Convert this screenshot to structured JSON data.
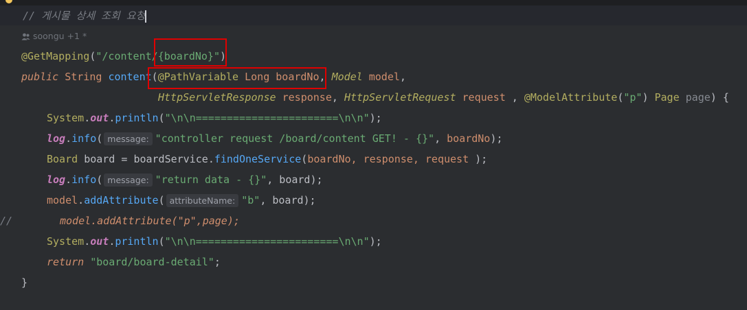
{
  "editor": {
    "comment_line": "// 게시물 상세 조회 요청",
    "author_hint": "soongu +1 *",
    "lines": {
      "get_mapping": {
        "annotation": "@GetMapping",
        "open": "(",
        "path_prefix": "\"/content/",
        "path_var": "{boardNo}\"",
        "close": ")"
      },
      "signature1": {
        "kw": "public",
        "ret": "String",
        "name": "content",
        "open": "(",
        "pv_ann": "@PathVariable",
        "pv_type": "Long",
        "pv_name": "boardNo",
        "comma": ",",
        "model_type": "Model",
        "model_name": "model",
        "comma2": ","
      },
      "signature2": {
        "resp_type": "HttpServletResponse",
        "resp_name": "response",
        "comma1": ",",
        "req_type": "HttpServletRequest",
        "req_name": "request",
        "comma2": " ,",
        "ma_ann": "@ModelAttribute",
        "ma_open": "(",
        "ma_str": "\"p\"",
        "ma_close": ")",
        "page_type": "Page",
        "page_name": "page",
        "end": ") {"
      },
      "println1": {
        "cls": "System",
        "dot": ".",
        "field": "out",
        "dot2": ".",
        "method": "println",
        "open": "(",
        "str": "\"\\n\\n=======================\\n\\n\"",
        "end": ");"
      },
      "log1": {
        "obj": "log",
        "dot": ".",
        "method": "info",
        "open": "(",
        "hint": "message:",
        "str": "\"controller request /board/content GET! - {}\"",
        "comma": ", ",
        "arg": "boardNo",
        "end": ");"
      },
      "board": {
        "type": "Board",
        "var": "board",
        "eq": " = ",
        "svc": "boardService",
        "dot": ".",
        "method": "findOneService",
        "open": "(",
        "args": "boardNo, response, request ",
        "end": ");"
      },
      "log2": {
        "obj": "log",
        "dot": ".",
        "method": "info",
        "open": "(",
        "hint": "message:",
        "str": "\"return data - {}\"",
        "comma": ", ",
        "arg": "board",
        "end": ");"
      },
      "model_add": {
        "obj": "model",
        "dot": ".",
        "method": "addAttribute",
        "open": "(",
        "hint": "attributeName:",
        "str": "\"b\"",
        "comma": ", ",
        "arg": "board",
        "end": ");"
      },
      "commented": {
        "gutter": "//",
        "text": "model.addAttribute(\"p\",page);"
      },
      "println2": {
        "cls": "System",
        "dot": ".",
        "field": "out",
        "dot2": ".",
        "method": "println",
        "open": "(",
        "str": "\"\\n\\n=======================\\n\\n\"",
        "end": ");"
      },
      "ret": {
        "kw": "return",
        "str": "\"board/board-detail\"",
        "end": ";"
      },
      "close": {
        "brace": "}"
      }
    }
  }
}
